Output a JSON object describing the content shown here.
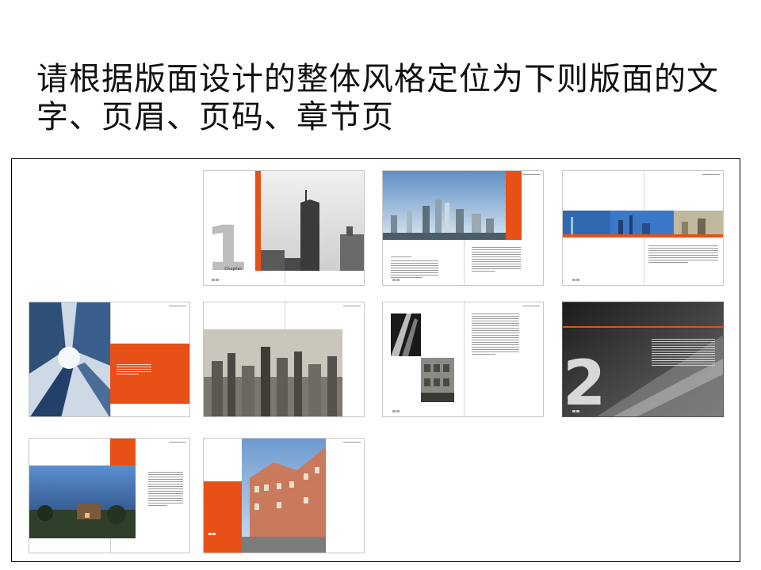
{
  "slide": {
    "title": "请根据版面设计的整体风格定位为下则版面的文字、页眉、页码、章节页"
  },
  "spreads": {
    "s1": {
      "chapter_number": "1",
      "chapter_word": "Chapter"
    },
    "s9": {
      "chapter_number": "2"
    }
  },
  "colors": {
    "accent_orange": "#e75016",
    "frame_border": "#000000"
  }
}
